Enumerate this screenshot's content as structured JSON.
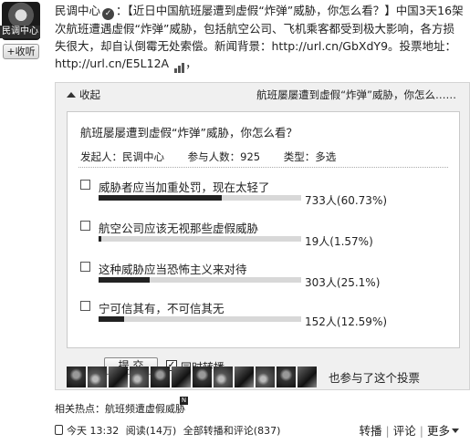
{
  "author": {
    "avatar_label": "民调中心",
    "follow_label": "+收听",
    "name": "民调中心"
  },
  "post": {
    "text": "：【近日中国航班屡遭到虚假“炸弹”威胁，你怎么看？】中国3天16架次航班遭遇虚假“炸弹”威胁，包括航空公司、飞机乘客都受到极大影响，各方损失很大，却自认倒霉无处索偿。新闻背景：http://url.cn/GbXdY9。投票地址：http://url.cn/E5L12A",
    "tail": "，"
  },
  "card": {
    "collapse_label": "收起",
    "head_title": "航班屡屡遭到虚假“炸弹”威胁，你怎么……",
    "poll": {
      "title": "航班屡屡遭到虚假“炸弹”威胁，你怎么看？",
      "initiator": "发起人：民调中心",
      "participants": "参与人数：925",
      "type": "类型：多选",
      "options": [
        {
          "label": "威胁者应当加重处罚，现在太轻了",
          "count": "733人(60.73%)",
          "percent": 60.73
        },
        {
          "label": "航空公司应该无视那些虚假威胁",
          "count": "19人(1.57%)",
          "percent": 1.57
        },
        {
          "label": "这种威胁应当恐怖主义来对待",
          "count": "303人(25.1%)",
          "percent": 25.1
        },
        {
          "label": "宁可信其有，不可信其无",
          "count": "152人(12.59%)",
          "percent": 12.59
        }
      ],
      "submit_label": "提 交",
      "repost_label": "同时转播"
    },
    "voters_note": "也参与了这个投票"
  },
  "hot_topic": "相关热点：航班频遭虚假威胁",
  "new_badge": "N",
  "footer": {
    "time": "今天  13:32",
    "reads": "阅读(14万)",
    "all_label": "全部转播和评论(837)",
    "repost": "转播",
    "comment": "评论",
    "more": "更多"
  }
}
